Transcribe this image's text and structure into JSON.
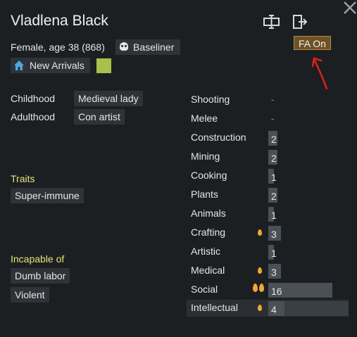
{
  "pawn": {
    "name": "Vladlena Black",
    "description": "Female, age 38 (868)",
    "xenotype": "Baseliner",
    "faction": "New Arrivals",
    "color": "#a9c04b"
  },
  "fa_button": "FA On",
  "backstory": {
    "childhood_label": "Childhood",
    "childhood": "Medieval lady",
    "adulthood_label": "Adulthood",
    "adulthood": "Con artist"
  },
  "traits": {
    "title": "Traits",
    "items": [
      "Super-immune"
    ]
  },
  "incapable": {
    "title": "Incapable of",
    "items": [
      "Dumb labor",
      "Violent"
    ]
  },
  "skills": [
    {
      "name": "Shooting",
      "level": "-",
      "passion": "none",
      "fill": 0
    },
    {
      "name": "Melee",
      "level": "-",
      "passion": "none",
      "fill": 0
    },
    {
      "name": "Construction",
      "level": "2",
      "passion": "none",
      "fill": 0.1
    },
    {
      "name": "Mining",
      "level": "2",
      "passion": "none",
      "fill": 0.1
    },
    {
      "name": "Cooking",
      "level": "1",
      "passion": "none",
      "fill": 0.05
    },
    {
      "name": "Plants",
      "level": "2",
      "passion": "none",
      "fill": 0.1
    },
    {
      "name": "Animals",
      "level": "1",
      "passion": "none",
      "fill": 0.05
    },
    {
      "name": "Crafting",
      "level": "3",
      "passion": "minor",
      "fill": 0.15
    },
    {
      "name": "Artistic",
      "level": "1",
      "passion": "none",
      "fill": 0.05
    },
    {
      "name": "Medical",
      "level": "3",
      "passion": "minor",
      "fill": 0.15
    },
    {
      "name": "Social",
      "level": "16",
      "passion": "major",
      "fill": 0.8
    },
    {
      "name": "Intellectual",
      "level": "4",
      "passion": "minor",
      "fill": 0.2
    }
  ]
}
